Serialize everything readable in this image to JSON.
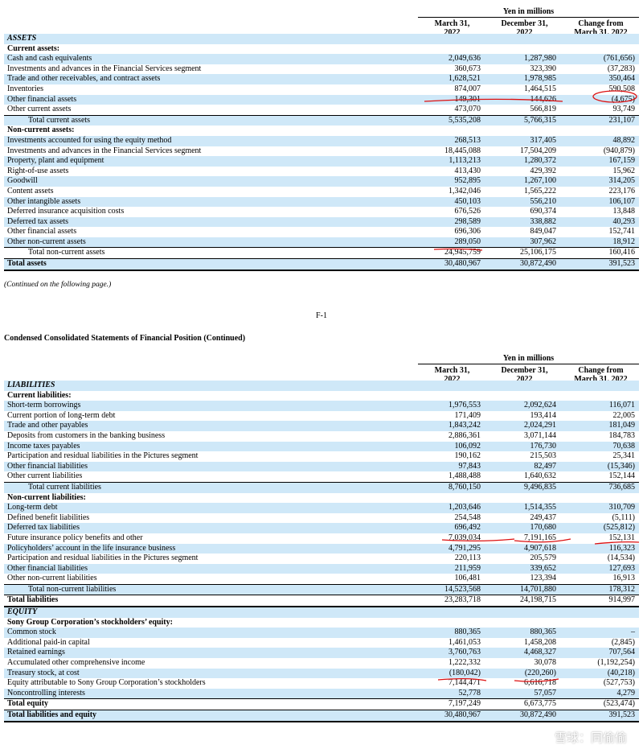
{
  "header": {
    "yen_label": "Yen in millions",
    "col1": "March 31,\n2022",
    "col2": "December 31,\n2022",
    "col3": "Change from\nMarch 31, 2022"
  },
  "assets": [
    {
      "label": "ASSETS",
      "type": "sec"
    },
    {
      "label": "Current assets:",
      "type": "sub"
    },
    {
      "label": "Cash and cash equivalents",
      "v": [
        "2,049,636",
        "1,287,980",
        "(761,656)"
      ]
    },
    {
      "label": "Investments and advances in the Financial Services segment",
      "v": [
        "360,673",
        "323,390",
        "(37,283)"
      ]
    },
    {
      "label": "Trade and other receivables, and contract assets",
      "v": [
        "1,628,521",
        "1,978,985",
        "350,464"
      ]
    },
    {
      "label": "Inventories",
      "v": [
        "874,007",
        "1,464,515",
        "590,508"
      ]
    },
    {
      "label": "Other financial assets",
      "v": [
        "149,301",
        "144,626",
        "(4,675)"
      ]
    },
    {
      "label": "Other current assets",
      "v": [
        "473,070",
        "566,819",
        "93,749"
      ]
    },
    {
      "label": "Total current assets",
      "type": "ind",
      "v": [
        "5,535,208",
        "5,766,315",
        "231,107"
      ]
    },
    {
      "label": "Non-current assets:",
      "type": "sub"
    },
    {
      "label": "Investments accounted for using the equity method",
      "v": [
        "268,513",
        "317,405",
        "48,892"
      ]
    },
    {
      "label": "Investments and advances in the Financial Services segment",
      "v": [
        "18,445,088",
        "17,504,209",
        "(940,879)"
      ]
    },
    {
      "label": "Property, plant and equipment",
      "v": [
        "1,113,213",
        "1,280,372",
        "167,159"
      ]
    },
    {
      "label": "Right-of-use assets",
      "v": [
        "413,430",
        "429,392",
        "15,962"
      ]
    },
    {
      "label": "Goodwill",
      "v": [
        "952,895",
        "1,267,100",
        "314,205"
      ]
    },
    {
      "label": "Content assets",
      "v": [
        "1,342,046",
        "1,565,222",
        "223,176"
      ]
    },
    {
      "label": "Other intangible assets",
      "v": [
        "450,103",
        "556,210",
        "106,107"
      ]
    },
    {
      "label": "Deferred insurance acquisition costs",
      "v": [
        "676,526",
        "690,374",
        "13,848"
      ]
    },
    {
      "label": "Deferred tax assets",
      "v": [
        "298,589",
        "338,882",
        "40,293"
      ]
    },
    {
      "label": "Other financial assets",
      "v": [
        "696,306",
        "849,047",
        "152,741"
      ]
    },
    {
      "label": "Other non-current assets",
      "v": [
        "289,050",
        "307,962",
        "18,912"
      ]
    },
    {
      "label": "Total non-current assets",
      "type": "ind",
      "v": [
        "24,945,759",
        "25,106,175",
        "160,416"
      ]
    },
    {
      "label": "Total assets",
      "type": "bold",
      "v": [
        "30,480,967",
        "30,872,490",
        "391,523"
      ]
    }
  ],
  "continued_note": "(Continued on the following page.)",
  "page_number": "F-1",
  "section_title": "Condensed Consolidated Statements of Financial Position (Continued)",
  "liabilities": [
    {
      "label": "LIABILITIES",
      "type": "sec"
    },
    {
      "label": "Current liabilities:",
      "type": "sub"
    },
    {
      "label": "Short-term borrowings",
      "v": [
        "1,976,553",
        "2,092,624",
        "116,071"
      ]
    },
    {
      "label": "Current portion of long-term debt",
      "v": [
        "171,409",
        "193,414",
        "22,005"
      ]
    },
    {
      "label": "Trade and other payables",
      "v": [
        "1,843,242",
        "2,024,291",
        "181,049"
      ]
    },
    {
      "label": "Deposits from customers in the banking business",
      "v": [
        "2,886,361",
        "3,071,144",
        "184,783"
      ]
    },
    {
      "label": "Income taxes payables",
      "v": [
        "106,092",
        "176,730",
        "70,638"
      ]
    },
    {
      "label": "Participation and residual liabilities in the Pictures segment",
      "v": [
        "190,162",
        "215,503",
        "25,341"
      ]
    },
    {
      "label": "Other financial liabilities",
      "v": [
        "97,843",
        "82,497",
        "(15,346)"
      ]
    },
    {
      "label": "Other current liabilities",
      "v": [
        "1,488,488",
        "1,640,632",
        "152,144"
      ]
    },
    {
      "label": "Total current liabilities",
      "type": "ind",
      "v": [
        "8,760,150",
        "9,496,835",
        "736,685"
      ]
    },
    {
      "label": "Non-current liabilities:",
      "type": "sub"
    },
    {
      "label": "Long-term debt",
      "v": [
        "1,203,646",
        "1,514,355",
        "310,709"
      ]
    },
    {
      "label": "Defined benefit liabilities",
      "v": [
        "254,548",
        "249,437",
        "(5,111)"
      ]
    },
    {
      "label": "Deferred tax liabilities",
      "v": [
        "696,492",
        "170,680",
        "(525,812)"
      ]
    },
    {
      "label": "Future insurance policy benefits and other",
      "v": [
        "7,039,034",
        "7,191,165",
        "152,131"
      ]
    },
    {
      "label": "Policyholders’ account in the life insurance business",
      "v": [
        "4,791,295",
        "4,907,618",
        "116,323"
      ]
    },
    {
      "label": "Participation and residual liabilities in the Pictures segment",
      "v": [
        "220,113",
        "205,579",
        "(14,534)"
      ]
    },
    {
      "label": "Other financial liabilities",
      "v": [
        "211,959",
        "339,652",
        "127,693"
      ]
    },
    {
      "label": "Other non-current liabilities",
      "v": [
        "106,481",
        "123,394",
        "16,913"
      ]
    },
    {
      "label": "Total non-current liabilities",
      "type": "ind",
      "v": [
        "14,523,568",
        "14,701,880",
        "178,312"
      ]
    },
    {
      "label": "Total liabilities",
      "type": "bold",
      "v": [
        "23,283,718",
        "24,198,715",
        "914,997"
      ]
    },
    {
      "label": "EQUITY",
      "type": "sec"
    },
    {
      "label": "Sony Group Corporation’s stockholders’ equity:",
      "type": "sub"
    },
    {
      "label": "Common stock",
      "v": [
        "880,365",
        "880,365",
        "–"
      ]
    },
    {
      "label": "Additional paid-in capital",
      "v": [
        "1,461,053",
        "1,458,208",
        "(2,845)"
      ]
    },
    {
      "label": "Retained earnings",
      "v": [
        "3,760,763",
        "4,468,327",
        "707,564"
      ]
    },
    {
      "label": "Accumulated other comprehensive income",
      "v": [
        "1,222,332",
        "30,078",
        "(1,192,254)"
      ]
    },
    {
      "label": "Treasury stock, at cost",
      "v": [
        "(180,042)",
        "(220,260)",
        "(40,218)"
      ]
    },
    {
      "label": "Equity attributable to Sony Group Corporation’s stockholders",
      "v": [
        "7,144,471",
        "6,616,718",
        "(527,753)"
      ]
    },
    {
      "label": "Noncontrolling interests",
      "v": [
        "52,778",
        "57,057",
        "4,279"
      ]
    },
    {
      "label": "Total equity",
      "type": "bold",
      "v": [
        "7,197,249",
        "6,673,775",
        "(523,474)"
      ]
    },
    {
      "label": "Total liabilities and equity",
      "type": "bold",
      "v": [
        "30,480,967",
        "30,872,490",
        "391,523"
      ]
    }
  ],
  "watermark": "雪球：同偷偷"
}
